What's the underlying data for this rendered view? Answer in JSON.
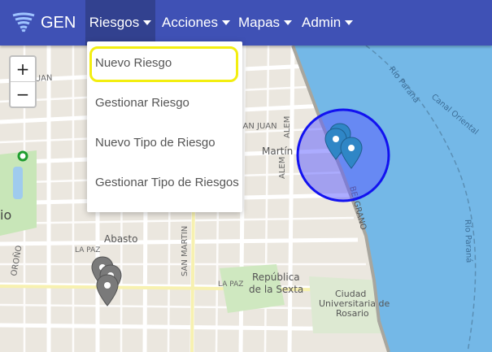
{
  "app": {
    "brand": "GEN",
    "logo_icon": "tornado-icon"
  },
  "nav": {
    "items": [
      {
        "label": "Riesgos",
        "active": true
      },
      {
        "label": "Acciones"
      },
      {
        "label": "Mapas"
      },
      {
        "label": "Admin"
      }
    ]
  },
  "dropdown": {
    "items": [
      {
        "label": "Nuevo Riesgo",
        "highlighted": true
      },
      {
        "label": "Gestionar Riesgo"
      },
      {
        "label": "Nuevo Tipo de Riesgo"
      },
      {
        "label": "Gestionar Tipo de Riesgos"
      }
    ]
  },
  "map": {
    "zoom_in": "+",
    "zoom_out": "−",
    "labels": {
      "juan_left": "JUAN",
      "san_juan": "SAN JUAN",
      "alem_1": "ALEM",
      "alem_2": "ALEM",
      "martin": "Martín",
      "belgrano": "BELGRANO",
      "rio_parana_top": "Río Paraná",
      "rio_parana_right": "Río Paraná",
      "canal_oriental": "Canal Oriental",
      "abasto": "Abasto",
      "san_martin": "SAN MARTIN",
      "republica": "República",
      "de_la_sexta": "de la Sexta",
      "la_paz_1": "LA PAZ",
      "la_paz_2": "LA PAZ",
      "ciudad": "Ciudad",
      "universitaria": "Universitaria de",
      "rosario": "Rosario",
      "orono": "OROÑO",
      "io": "io"
    },
    "colors": {
      "water": "#74b8e7",
      "circle_stroke": "#1212f0",
      "circle_fill": "#5a5aff",
      "marker": "#2f86c6"
    }
  }
}
